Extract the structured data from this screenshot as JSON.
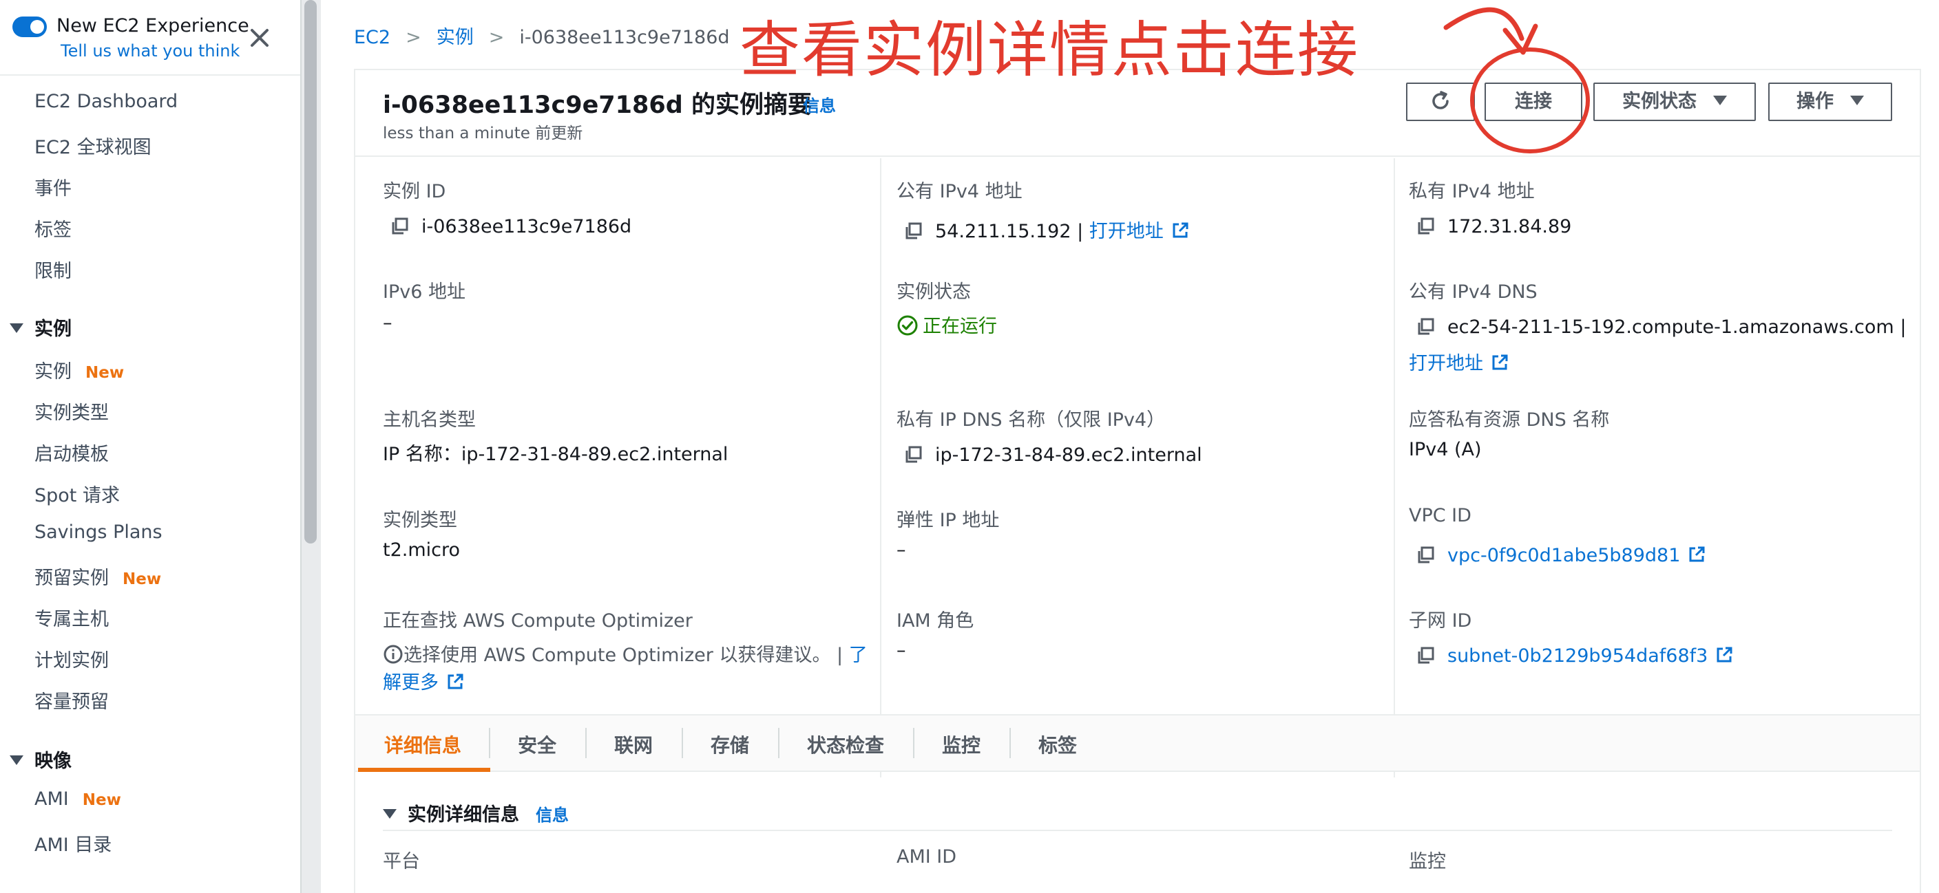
{
  "sidebar": {
    "toggle_title": "New EC2 Experience",
    "toggle_link": "Tell us what you think",
    "items_top": [
      "EC2 Dashboard",
      "EC2 全球视图",
      "事件",
      "标签",
      "限制"
    ],
    "section_instances": "实例",
    "instances_items": [
      "实例",
      "实例类型",
      "启动模板",
      "Spot 请求",
      "Savings Plans",
      "预留实例",
      "专属主机",
      "计划实例",
      "容量预留"
    ],
    "new_badge": "New",
    "section_images": "映像",
    "images_items": [
      "AMI",
      "AMI 目录"
    ]
  },
  "breadcrumb": {
    "root": "EC2",
    "instances": "实例",
    "current": "i-0638ee113c9e7186d"
  },
  "annotation": {
    "text": "查看实例详情点击连接",
    "color": "#e23b2e"
  },
  "header": {
    "title": "i-0638ee113c9e7186d 的实例摘要",
    "info": "信息",
    "updated": "less than a minute 前更新",
    "buttons": {
      "connect": "连接",
      "instance_state": "实例状态",
      "actions": "操作"
    }
  },
  "summary": {
    "instance_id_label": "实例 ID",
    "instance_id": "i-0638ee113c9e7186d",
    "public_ipv4_label": "公有 IPv4 地址",
    "public_ipv4": "54.211.15.192",
    "open_address": "打开地址",
    "private_ipv4_label": "私有 IPv4 地址",
    "private_ipv4": "172.31.84.89",
    "ipv6_label": "IPv6 地址",
    "ipv6": "–",
    "state_label": "实例状态",
    "state": "正在运行",
    "public_dns_label": "公有 IPv4 DNS",
    "public_dns": "ec2-54-211-15-192.compute-1.amazonaws.com",
    "hostname_type_label": "主机名类型",
    "hostname_type": "IP 名称：ip-172-31-84-89.ec2.internal",
    "private_dns_label": "私有 IP DNS 名称（仅限 IPv4）",
    "private_dns": "ip-172-31-84-89.ec2.internal",
    "answer_dns_label": "应答私有资源 DNS 名称",
    "answer_dns": "IPv4 (A)",
    "instance_type_label": "实例类型",
    "instance_type": "t2.micro",
    "elastic_ip_label": "弹性 IP 地址",
    "elastic_ip": "–",
    "vpc_label": "VPC ID",
    "vpc": "vpc-0f9c0d1abe5b89d81",
    "optimizer_label": "正在查找 AWS Compute Optimizer",
    "optimizer_text": "选择使用 AWS Compute Optimizer 以获得建议。 |",
    "learn_more_1": "了",
    "learn_more_2": "解更多",
    "iam_label": "IAM 角色",
    "iam": "–",
    "subnet_label": "子网 ID",
    "subnet": "subnet-0b2129b954daf68f3"
  },
  "tabs": [
    "详细信息",
    "安全",
    "联网",
    "存储",
    "状态检查",
    "监控",
    "标签"
  ],
  "details": {
    "heading": "实例详细信息",
    "info": "信息",
    "platform_label": "平台",
    "ami_id_label": "AMI ID",
    "monitoring_label": "监控"
  },
  "colors": {
    "link": "#0972d3",
    "active_tab": "#ec7211",
    "running": "#1d8102"
  }
}
